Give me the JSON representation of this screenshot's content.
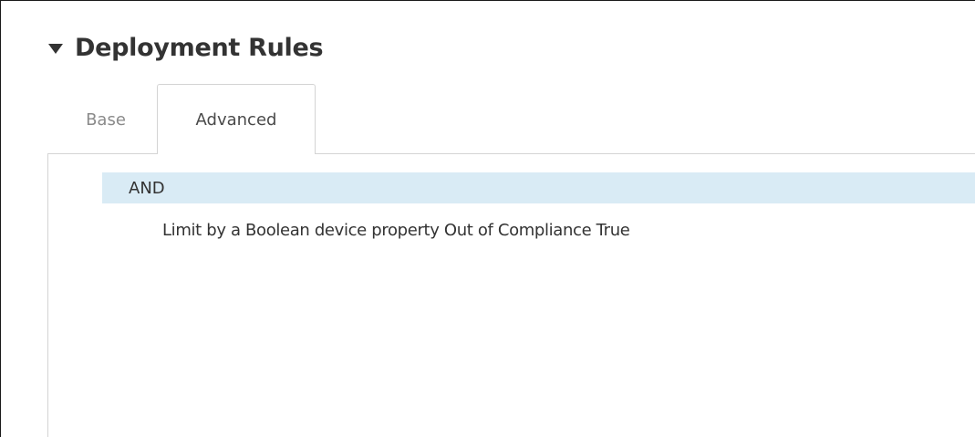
{
  "section": {
    "title": "Deployment Rules",
    "collapse_icon": "caret-down-icon"
  },
  "tabs": [
    {
      "label": "Base",
      "selected": false
    },
    {
      "label": "Advanced",
      "selected": true
    }
  ],
  "rules": {
    "operator": "AND",
    "items": [
      "Limit by a Boolean device property Out of Compliance True"
    ]
  },
  "colors": {
    "operator_row_bg": "#d9ebf5",
    "border": "#d4d4d4",
    "text": "#333333",
    "inactive_tab_text": "#8a8a8a"
  }
}
